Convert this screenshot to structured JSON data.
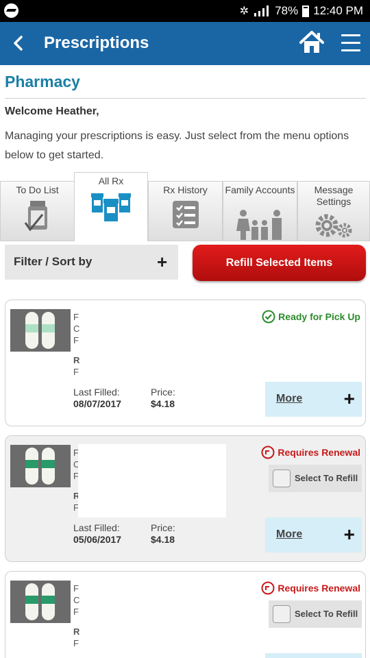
{
  "status_bar": {
    "battery": "78%",
    "time": "12:40 PM"
  },
  "header": {
    "title": "Prescriptions"
  },
  "page": {
    "section_title": "Pharmacy",
    "welcome": "Welcome Heather,",
    "intro": "Managing your prescriptions is easy. Just select from the menu options below to get started."
  },
  "tabs": [
    {
      "label": "To Do List"
    },
    {
      "label": "All Rx",
      "active": true
    },
    {
      "label": "Rx History"
    },
    {
      "label": "Family Accounts"
    },
    {
      "label": "Message Settings"
    }
  ],
  "filter": {
    "label": "Filter / Sort by",
    "plus": "+"
  },
  "refill_button": "Refill Selected Items",
  "cards": [
    {
      "status": "Ready for Pick Up",
      "initials": [
        "F",
        "C",
        "F",
        "R",
        "F"
      ],
      "last_filled_label": "Last Filled:",
      "last_filled": "08/07/2017",
      "price_label": "Price:",
      "price": "$4.18",
      "more": "More",
      "plus": "+"
    },
    {
      "status": "Requires Renewal",
      "select": "Select To Refill",
      "initials": [
        "F",
        "C",
        "F",
        "R",
        "F"
      ],
      "last_filled_label": "Last Filled:",
      "last_filled": "05/06/2017",
      "price_label": "Price:",
      "price": "$4.18",
      "more": "More",
      "plus": "+"
    },
    {
      "status": "Requires Renewal",
      "select": "Select To Refill",
      "initials": [
        "F",
        "C",
        "F",
        "R",
        "F"
      ]
    }
  ],
  "colors": {
    "header_blue": "#1a66a5",
    "title_teal": "#1a7fa6",
    "refill_red": "#c81818",
    "ready_green": "#2b8a2b",
    "more_bg": "#d6eef8"
  }
}
